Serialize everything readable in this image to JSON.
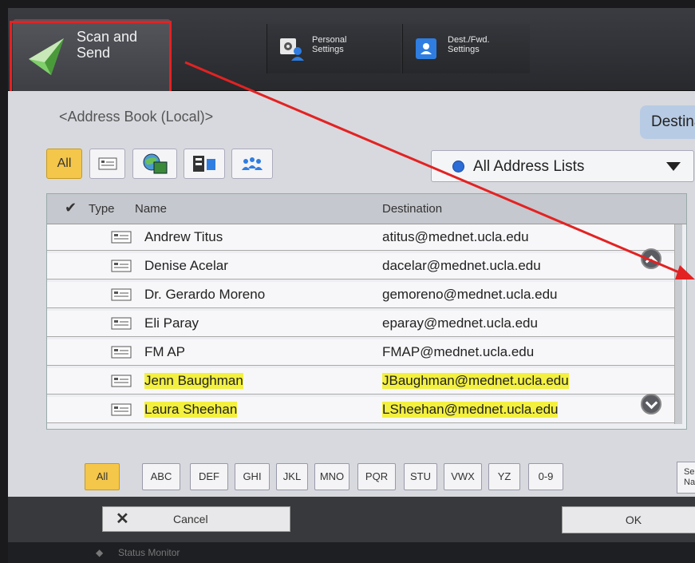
{
  "topbar": {
    "app_label": "Scan and\nSend",
    "personal_settings": "Personal\nSettings",
    "dest_settings": "Dest./Fwd.\nSettings"
  },
  "address_book": {
    "title": "<Address Book (Local)>",
    "destination_tab": "Destination",
    "filter_all": "All",
    "address_list_select": "All Address Lists"
  },
  "table": {
    "headers": {
      "check": "✔",
      "type": "Type",
      "name": "Name",
      "destination": "Destination"
    },
    "rows": [
      {
        "name": "Andrew Titus",
        "destination": "atitus@mednet.ucla.edu",
        "highlighted": false
      },
      {
        "name": "Denise Acelar",
        "destination": "dacelar@mednet.ucla.edu",
        "highlighted": false
      },
      {
        "name": "Dr. Gerardo Moreno",
        "destination": "gemoreno@mednet.ucla.edu",
        "highlighted": false
      },
      {
        "name": "Eli Paray",
        "destination": "eparay@mednet.ucla.edu",
        "highlighted": false
      },
      {
        "name": "FM AP",
        "destination": "FMAP@mednet.ucla.edu",
        "highlighted": false
      },
      {
        "name": "Jenn Baughman",
        "destination": "JBaughman@mednet.ucla.edu",
        "highlighted": true
      },
      {
        "name": "Laura Sheehan",
        "destination": "LSheehan@mednet.ucla.edu",
        "highlighted": true
      }
    ]
  },
  "letter_filters": [
    "All",
    "ABC",
    "DEF",
    "GHI",
    "JKL",
    "MNO",
    "PQR",
    "STU",
    "VWX",
    "YZ",
    "0-9"
  ],
  "select_by_name": "Se\nNa",
  "bottom": {
    "cancel": "Cancel",
    "ok": "OK"
  },
  "footer": {
    "status": "Status Monitor"
  },
  "colors": {
    "annotation_red": "#e32222",
    "highlight_yellow": "#f3f040",
    "selected_tab": "#f4c64a"
  }
}
